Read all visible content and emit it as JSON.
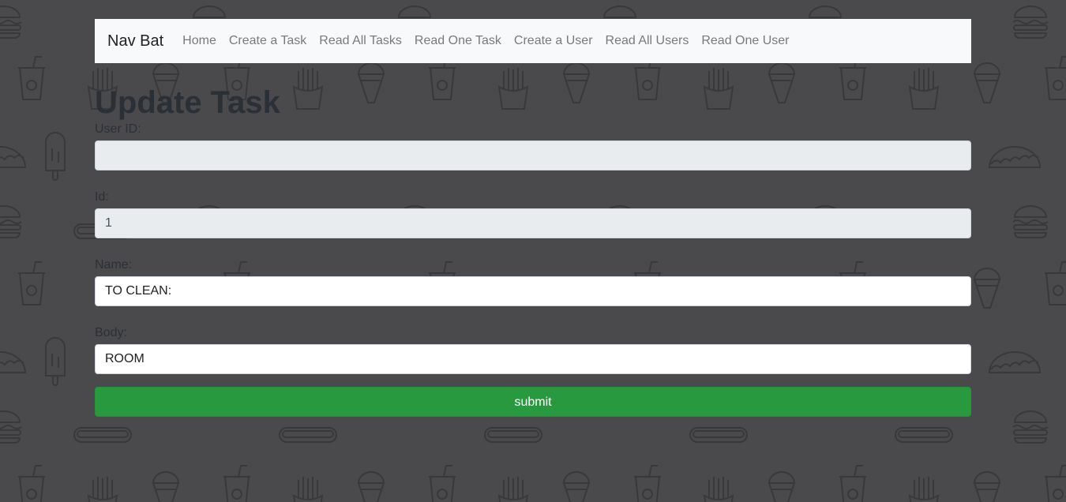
{
  "navbar": {
    "brand": "Nav Bat",
    "links": [
      "Home",
      "Create a Task",
      "Read All Tasks",
      "Read One Task",
      "Create a User",
      "Read All Users",
      "Read One User"
    ]
  },
  "page": {
    "title": "Update Task"
  },
  "form": {
    "user_id": {
      "label": "User ID:",
      "value": ""
    },
    "id": {
      "label": "Id:",
      "value": "1"
    },
    "name": {
      "label": "Name:",
      "value": "TO CLEAN:"
    },
    "body": {
      "label": "Body:",
      "value": "ROOM"
    },
    "submit_label": "submit"
  },
  "colors": {
    "background": "#4a4a4c",
    "navbar_bg": "#f8f9fa",
    "submit_bg": "#28993f",
    "readonly_input_bg": "#e9ecef"
  },
  "background_pattern_icons": [
    "burger-icon",
    "soda-cup-icon",
    "fries-icon",
    "ice-cream-cone-icon",
    "popsicle-icon",
    "taco-icon",
    "hotdog-icon",
    "donut-icon"
  ]
}
